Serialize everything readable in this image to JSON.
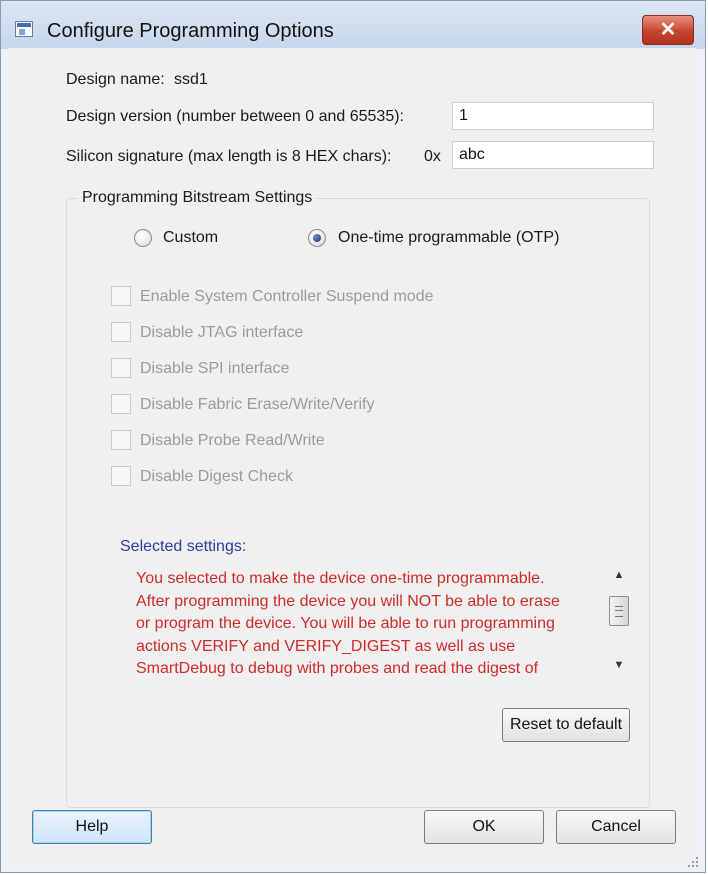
{
  "window": {
    "title": "Configure Programming Options",
    "close_label": "✕"
  },
  "design": {
    "name_label": "Design name:",
    "name_value": "ssd1",
    "version_label": "Design version (number between 0 and 65535):",
    "version_value": "1",
    "signature_label": "Silicon signature (max length is 8 HEX chars):",
    "signature_prefix": "0x",
    "signature_value": "abc"
  },
  "bitstream": {
    "group_title": "Programming Bitstream Settings",
    "radios": [
      {
        "label": "Custom",
        "checked": false
      },
      {
        "label": "One-time programmable (OTP)",
        "checked": true
      }
    ],
    "options": [
      {
        "label": "Enable System Controller Suspend mode",
        "checked": false,
        "enabled": false
      },
      {
        "label": "Disable JTAG interface",
        "checked": false,
        "enabled": false
      },
      {
        "label": "Disable SPI interface",
        "checked": false,
        "enabled": false
      },
      {
        "label": "Disable Fabric Erase/Write/Verify",
        "checked": false,
        "enabled": false
      },
      {
        "label": "Disable Probe Read/Write",
        "checked": false,
        "enabled": false
      },
      {
        "label": "Disable Digest Check",
        "checked": false,
        "enabled": false
      }
    ],
    "selected_label": "Selected settings:",
    "selected_text": "You selected to make the device one-time programmable.\nAfter programming the device you will NOT be able to erase\nor program the device. You will be able to run programming\nactions VERIFY and VERIFY_DIGEST as well as use\nSmartDebug to debug with probes and read the digest of",
    "reset_label": "Reset to default"
  },
  "buttons": {
    "help": "Help",
    "ok": "OK",
    "cancel": "Cancel"
  },
  "colors": {
    "warning_text": "#d02a2a",
    "selected_label": "#2b3aa5",
    "disabled_text": "#9a9a9a",
    "close_button": "#c6442e"
  },
  "icons": {
    "app": "window-app-icon",
    "close": "close-x-icon",
    "scroll_up": "scroll-up-arrow-icon",
    "scroll_down": "scroll-down-arrow-icon",
    "resize": "resize-grip-icon"
  }
}
